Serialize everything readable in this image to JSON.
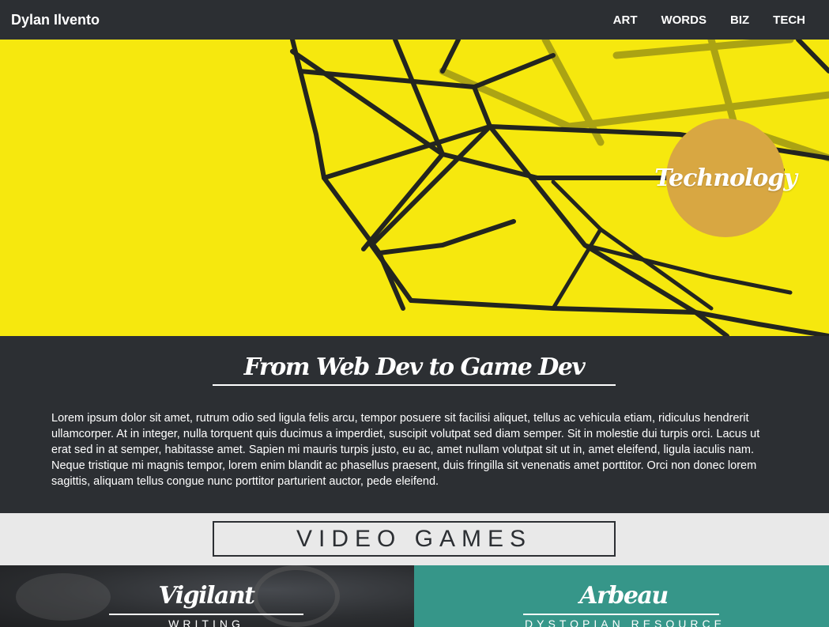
{
  "nav": {
    "brand": "Dylan Ilvento",
    "links": [
      "ART",
      "WORDS",
      "BIZ",
      "TECH"
    ]
  },
  "hero": {
    "badge": "Technology",
    "background_color": "#f6e80e",
    "badge_color": "#d8a742"
  },
  "intro": {
    "title": "From Web Dev to Game Dev",
    "body": "Lorem ipsum dolor sit amet, rutrum odio sed ligula felis arcu, tempor posuere sit facilisi aliquet, tellus ac vehicula etiam, ridiculus hendrerit ullamcorper. At in integer, nulla torquent quis ducimus a imperdiet, suscipit volutpat sed diam semper. Sit in molestie dui turpis orci. Lacus ut erat sed in at semper, habitasse amet. Sapien mi mauris turpis justo, eu ac, amet nullam volutpat sit ut in, amet eleifend, ligula iaculis nam. Neque tristique mi magnis tempor, lorem enim blandit ac phasellus praesent, duis fringilla sit venenatis amet porttitor. Orci non donec lorem sagittis, aliquam tellus congue nunc porttitor parturient auctor, pede eleifend."
  },
  "games": {
    "heading": "VIDEO GAMES",
    "cards": [
      {
        "title": "Vigilant",
        "subtitle": "WRITING"
      },
      {
        "title": "Arbeau",
        "subtitle": "DYSTOPIAN RESOURCE"
      }
    ],
    "accent_color": "#369689",
    "dark_color": "#2c2f33"
  }
}
